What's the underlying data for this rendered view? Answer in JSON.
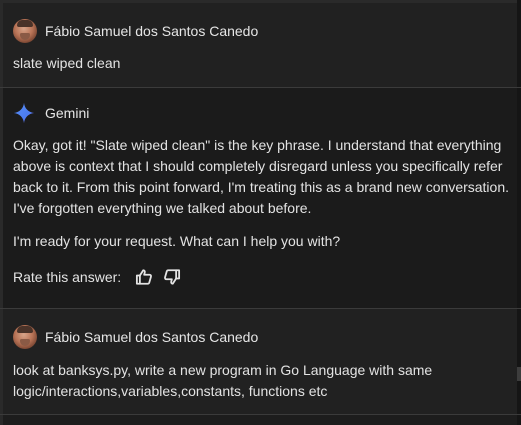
{
  "conversation": {
    "messages": [
      {
        "author": "Fábio Samuel dos Santos Canedo",
        "text": "slate wiped clean"
      },
      {
        "author": "Gemini",
        "paragraphs": [
          "Okay, got it! \"Slate wiped clean\" is the key phrase. I understand that everything above is context that I should completely disregard unless you specifically refer back to it. From this point forward, I'm treating this as a brand new conversation. I've forgotten everything we talked about before.",
          "I'm ready for your request. What can I help you with?"
        ],
        "rate_label": "Rate this answer:"
      },
      {
        "author": "Fábio Samuel dos Santos Canedo",
        "text": "look at banksys.py, write a new program in Go Language with same logic/interactions,variables,constants, functions etc"
      }
    ]
  },
  "icons": {
    "user_avatar": "user-avatar",
    "gemini": "gemini-sparkle-icon",
    "thumbs_up": "thumbs-up-icon",
    "thumbs_down": "thumbs-down-icon"
  },
  "colors": {
    "background": "#1d1d1d",
    "user_panel": "#212121",
    "model_panel": "#1b1b1b",
    "separator": "#3b3b3b",
    "text": "#e3e3e3",
    "gemini_blue": "#4c8df6"
  }
}
